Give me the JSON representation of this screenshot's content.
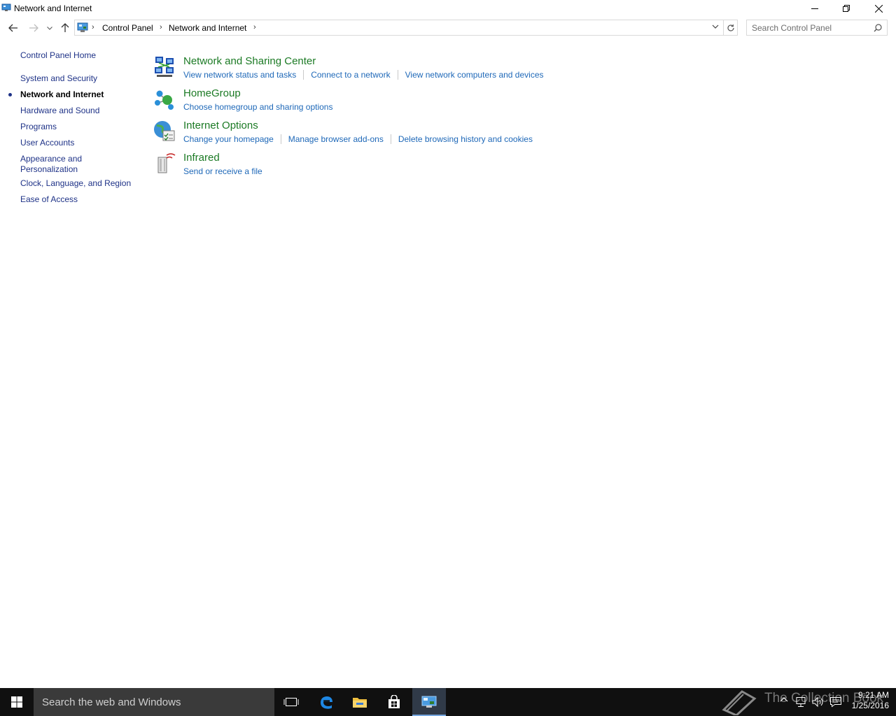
{
  "window": {
    "title": "Network and Internet",
    "controls": {
      "minimize": "minimize",
      "restore": "restore",
      "close": "close"
    }
  },
  "address": {
    "breadcrumbs": [
      "Control Panel",
      "Network and Internet"
    ],
    "search_placeholder": "Search Control Panel"
  },
  "sidebar": {
    "home": "Control Panel Home",
    "items": [
      {
        "label": "System and Security",
        "active": false
      },
      {
        "label": "Network and Internet",
        "active": true
      },
      {
        "label": "Hardware and Sound",
        "active": false
      },
      {
        "label": "Programs",
        "active": false
      },
      {
        "label": "User Accounts",
        "active": false
      },
      {
        "label": "Appearance and\nPersonalization",
        "active": false
      },
      {
        "label": "Clock, Language, and Region",
        "active": false
      },
      {
        "label": "Ease of Access",
        "active": false
      }
    ]
  },
  "categories": [
    {
      "title": "Network and Sharing Center",
      "icon": "network-sharing-icon",
      "links": [
        "View network status and tasks",
        "Connect to a network",
        "View network computers and devices"
      ]
    },
    {
      "title": "HomeGroup",
      "icon": "homegroup-icon",
      "links": [
        "Choose homegroup and sharing options"
      ]
    },
    {
      "title": "Internet Options",
      "icon": "internet-options-icon",
      "links": [
        "Change your homepage",
        "Manage browser add-ons",
        "Delete browsing history and cookies"
      ]
    },
    {
      "title": "Infrared",
      "icon": "infrared-icon",
      "links": [
        "Send or receive a file"
      ]
    }
  ],
  "taskbar": {
    "search_placeholder": "Search the web and Windows",
    "apps": [
      "task-view-icon",
      "edge-icon",
      "file-explorer-icon",
      "store-icon",
      "control-panel-icon"
    ],
    "watermark": "The Collection Book",
    "time": "9:21 AM",
    "date": "1/25/2016"
  },
  "colors": {
    "link": "#1e68b8",
    "category_title": "#1b7a24",
    "nav_link": "#1e3287",
    "taskbar": "#101010"
  }
}
